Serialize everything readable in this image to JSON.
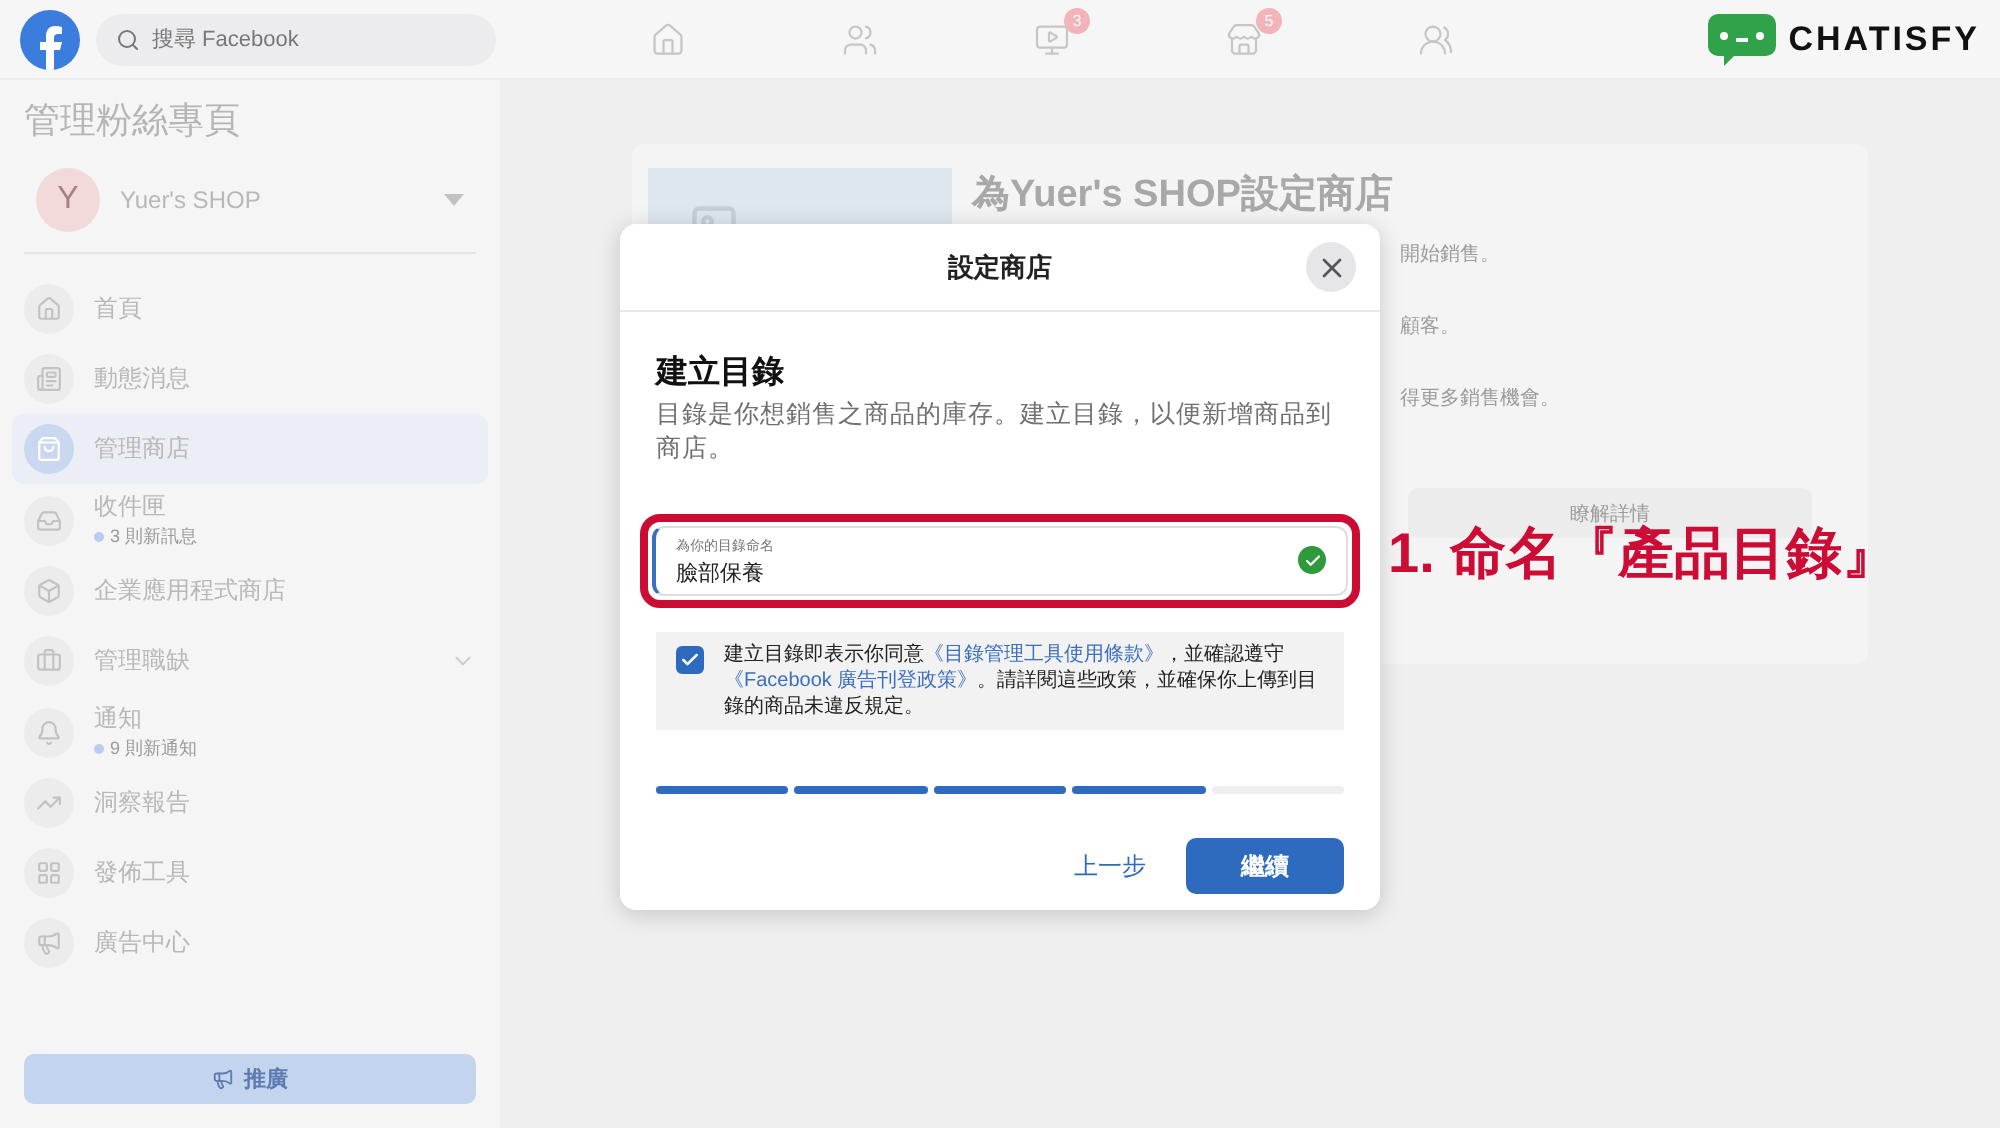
{
  "topbar": {
    "search": {
      "placeholder": "搜尋 Facebook"
    },
    "nav": [
      {
        "kind": "home"
      },
      {
        "kind": "friends"
      },
      {
        "kind": "video",
        "badge": "3"
      },
      {
        "kind": "store",
        "badge": "5"
      },
      {
        "kind": "groups"
      }
    ],
    "brand": "CHATISFY"
  },
  "sidebar": {
    "title": "管理粉絲專頁",
    "page": {
      "initial": "Y",
      "name": "Yuer's SHOP"
    },
    "items": [
      {
        "kind": "home",
        "label": "首頁",
        "selected": false,
        "expandable": false
      },
      {
        "kind": "feed",
        "label": "動態消息",
        "selected": false,
        "expandable": false
      },
      {
        "kind": "shop",
        "label": "管理商店",
        "selected": true,
        "expandable": false
      },
      {
        "kind": "inbox",
        "label": "收件匣",
        "sub": "3 則新訊息",
        "selected": false,
        "expandable": false
      },
      {
        "kind": "apps",
        "label": "企業應用程式商店",
        "selected": false,
        "expandable": false
      },
      {
        "kind": "jobs",
        "label": "管理職缺",
        "selected": false,
        "expandable": true
      },
      {
        "kind": "bell",
        "label": "通知",
        "sub": "9 則新通知",
        "selected": false,
        "expandable": false
      },
      {
        "kind": "insights",
        "label": "洞察報告",
        "selected": false,
        "expandable": false
      },
      {
        "kind": "publish",
        "label": "發佈工具",
        "selected": false,
        "expandable": false
      },
      {
        "kind": "ads",
        "label": "廣告中心",
        "selected": false,
        "expandable": false
      }
    ],
    "promote": "推廣"
  },
  "shop_card": {
    "title": "為Yuer's SHOP設定商店",
    "lines": [
      "開始銷售。",
      "顧客。",
      "得更多銷售機會。"
    ],
    "learn_more": "瞭解詳情"
  },
  "dialog": {
    "title": "設定商店",
    "heading": "建立目錄",
    "description": "目錄是你想銷售之商品的庫存。建立目錄，以便新增商品到商店。",
    "field": {
      "label": "為你的目錄命名",
      "value": "臉部保養",
      "valid": true
    },
    "consent": {
      "checked": true,
      "parts": [
        {
          "text": "建立目錄即表示你同意",
          "link": false
        },
        {
          "text": "《目錄管理工具使用條款》",
          "link": true
        },
        {
          "text": "，並確認遵守",
          "link": false
        },
        {
          "text": "《Facebook 廣告刊登政策》",
          "link": true
        },
        {
          "text": "。請詳閱這些政策，並確保你上傳到目錄的商品未違反規定。",
          "link": false
        }
      ]
    },
    "steps": [
      {
        "done": true
      },
      {
        "done": true
      },
      {
        "done": true
      },
      {
        "done": true
      },
      {
        "done": false
      }
    ],
    "back": "上一步",
    "next": "繼續"
  },
  "annotation": "1. 命名『產品目錄』"
}
